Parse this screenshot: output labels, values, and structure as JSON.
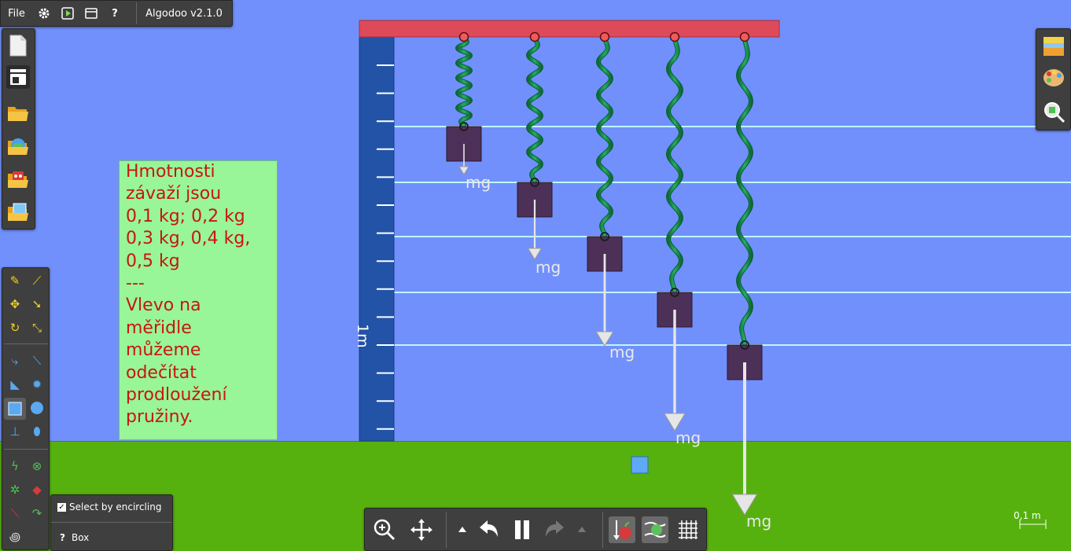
{
  "topbar": {
    "file_label": "File",
    "version_label": "Algodoo v2.1.0",
    "help_glyph": "?",
    "icons": [
      "gear-icon",
      "play-icon",
      "window-icon",
      "help-icon"
    ]
  },
  "note": {
    "lines": [
      "Hmotnosti",
      "závaží jsou",
      "0,1 kg; 0,2 kg",
      "0,3 kg, 0,4 kg,",
      "0,5 kg",
      "---",
      "Vlevo na",
      "měřidle",
      "můžeme",
      "odečítat",
      "prodloužení",
      "pružiny."
    ]
  },
  "ruler": {
    "label": "1m"
  },
  "force_labels": [
    "mg",
    "mg",
    "mg",
    "mg",
    "mg"
  ],
  "masses_kg": [
    0.1,
    0.2,
    0.3,
    0.4,
    0.5
  ],
  "options": {
    "select_by_encircling": "Select by encircling",
    "select_checked": true,
    "help_glyph": "?",
    "current_tool": "Box"
  },
  "scale": {
    "label": "0,1 m"
  },
  "colors": {
    "sky": "#7190fb",
    "ground": "#56b10e",
    "beam": "#de4a5a",
    "ruler": "#2353a6",
    "weight": "#4d3058",
    "spring": "#13864a",
    "note_bg": "#98f598",
    "note_text": "#c8160e",
    "panel": "#3f3f3f"
  }
}
